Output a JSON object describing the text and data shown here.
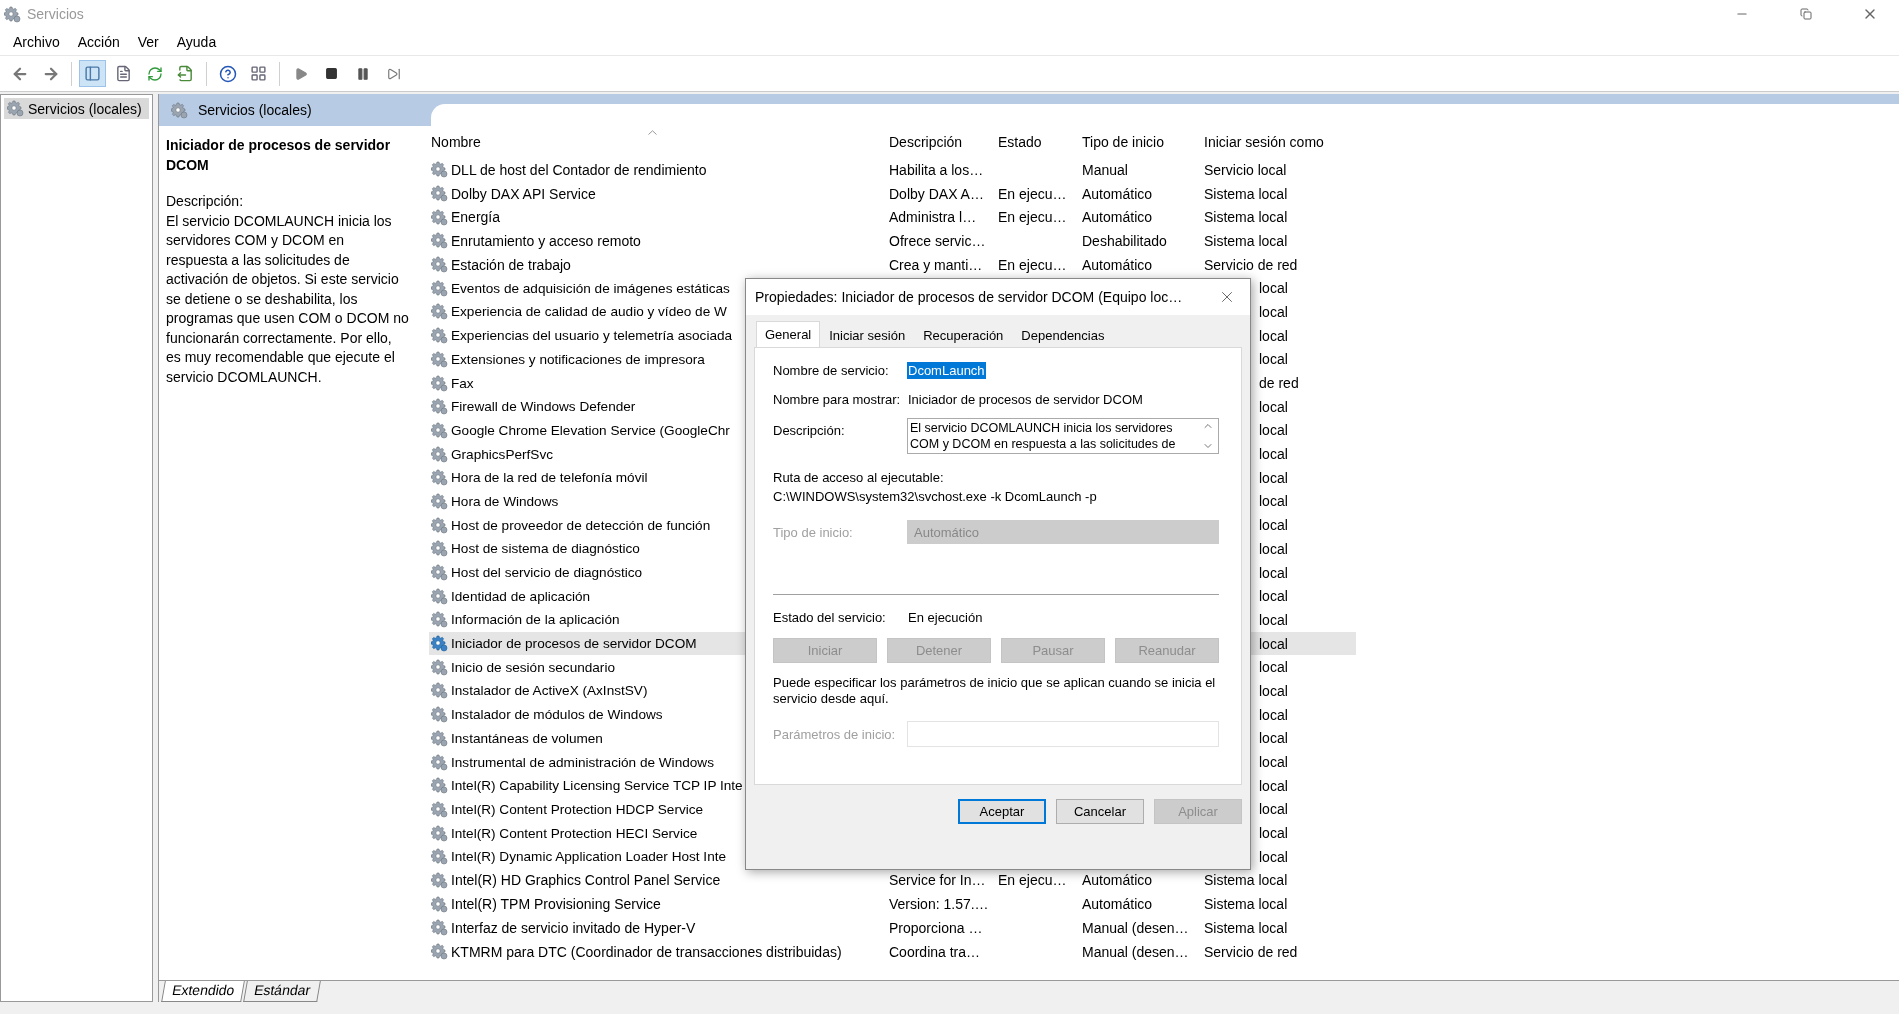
{
  "window": {
    "title": "Servicios"
  },
  "menu": [
    "Archivo",
    "Acción",
    "Ver",
    "Ayuda"
  ],
  "tree": {
    "items": [
      {
        "label": "Servicios (locales)",
        "selected": true
      }
    ]
  },
  "panel": {
    "title": "Servicios (locales)"
  },
  "details": {
    "title": "Iniciador de procesos de servidor DCOM",
    "description_label": "Descripción:",
    "description": "El servicio DCOMLAUNCH inicia los servidores COM y DCOM en respuesta a las solicitudes de activación de objetos. Si este servicio se detiene o se deshabilita, los programas que usen COM o DCOM no funcionarán correctamente. Por ello, es muy recomendable que ejecute el servicio DCOMLAUNCH."
  },
  "table": {
    "columns": [
      "Nombre",
      "Descripción",
      "Estado",
      "Tipo de inicio",
      "Iniciar sesión como"
    ],
    "rows": [
      {
        "kind": "full",
        "name": "DLL de host del Contador de rendimiento",
        "description": "Habilita a los…",
        "startup": "Manual",
        "logon": "Servicio local",
        "selected": false
      },
      {
        "kind": "full",
        "name": "Dolby DAX API Service",
        "description": "Dolby DAX A…",
        "status": "En ejecu…",
        "startup": "Automático",
        "logon": "Sistema local",
        "selected": false
      },
      {
        "kind": "full",
        "name": "Energía",
        "description": "Administra l…",
        "status": "En ejecu…",
        "startup": "Automático",
        "logon": "Sistema local",
        "selected": false
      },
      {
        "kind": "full",
        "name": "Enrutamiento y acceso remoto",
        "description": "Ofrece servic…",
        "startup": "Deshabilitado",
        "logon": "Sistema local",
        "selected": false
      },
      {
        "kind": "full",
        "name": "Estación de trabajo",
        "description": "Crea y manti…",
        "status": "En ejecu…",
        "startup": "Automático",
        "logon": "Servicio de red",
        "selected": false
      },
      {
        "kind": "covered",
        "name": "Eventos de adquisición de imágenes estáticas",
        "logon": "local",
        "selected": false
      },
      {
        "kind": "covered",
        "name": "Experiencia de calidad de audio y vídeo de W",
        "logon": "local",
        "selected": false
      },
      {
        "kind": "covered",
        "name": "Experiencias del usuario y telemetría asociada",
        "logon": "local",
        "selected": false
      },
      {
        "kind": "covered",
        "name": "Extensiones y notificaciones de impresora",
        "logon": "local",
        "selected": false
      },
      {
        "kind": "covered",
        "name": "Fax",
        "logon": "de red",
        "selected": false
      },
      {
        "kind": "covered",
        "name": "Firewall de Windows Defender",
        "logon": "local",
        "selected": false
      },
      {
        "kind": "covered",
        "name": "Google Chrome Elevation Service (GoogleChr",
        "logon": "local",
        "selected": false
      },
      {
        "kind": "covered",
        "name": "GraphicsPerfSvc",
        "logon": "local",
        "selected": false
      },
      {
        "kind": "covered",
        "name": "Hora de la red de telefonía móvil",
        "logon": "local",
        "selected": false
      },
      {
        "kind": "covered",
        "name": "Hora de Windows",
        "logon": "local",
        "selected": false
      },
      {
        "kind": "covered",
        "name": "Host de proveedor de detección de función",
        "logon": "local",
        "selected": false
      },
      {
        "kind": "covered",
        "name": "Host de sistema de diagnóstico",
        "logon": "local",
        "selected": false
      },
      {
        "kind": "covered",
        "name": "Host del servicio de diagnóstico",
        "logon": "local",
        "selected": false
      },
      {
        "kind": "covered",
        "name": "Identidad de aplicación",
        "logon": "local",
        "selected": false
      },
      {
        "kind": "covered",
        "name": "Información de la aplicación",
        "logon": "local",
        "selected": false
      },
      {
        "kind": "covered",
        "name": "Iniciador de procesos de servidor DCOM",
        "logon": "local",
        "selected": true
      },
      {
        "kind": "covered",
        "name": "Inicio de sesión secundario",
        "logon": "local",
        "selected": false
      },
      {
        "kind": "covered",
        "name": "Instalador de ActiveX (AxInstSV)",
        "logon": "local",
        "selected": false
      },
      {
        "kind": "covered",
        "name": "Instalador de módulos de Windows",
        "logon": "local",
        "selected": false
      },
      {
        "kind": "covered",
        "name": "Instantáneas de volumen",
        "logon": "local",
        "selected": false
      },
      {
        "kind": "covered",
        "name": "Instrumental de administración de Windows",
        "logon": "local",
        "selected": false
      },
      {
        "kind": "covered",
        "name": "Intel(R) Capability Licensing Service TCP IP Inte",
        "logon": "local",
        "selected": false
      },
      {
        "kind": "covered",
        "name": "Intel(R) Content Protection HDCP Service",
        "logon": "local",
        "selected": false
      },
      {
        "kind": "covered",
        "name": "Intel(R) Content Protection HECI Service",
        "logon": "local",
        "selected": false
      },
      {
        "kind": "covered",
        "name": "Intel(R) Dynamic Application Loader Host Inte",
        "logon": "local",
        "selected": false
      },
      {
        "kind": "full",
        "name": "Intel(R) HD Graphics Control Panel Service",
        "description": "Service for In…",
        "status": "En ejecu…",
        "startup": "Automático",
        "logon": "Sistema local",
        "selected": false
      },
      {
        "kind": "full",
        "name": "Intel(R) TPM Provisioning Service",
        "description": "Version: 1.57.…",
        "startup": "Automático",
        "logon": "Sistema local",
        "selected": false
      },
      {
        "kind": "full",
        "name": "Interfaz de servicio invitado de Hyper-V",
        "description": "Proporciona …",
        "startup": "Manual (desen…",
        "logon": "Sistema local",
        "selected": false
      },
      {
        "kind": "full",
        "name": "KTMRM para DTC (Coordinador de transacciones distribuidas)",
        "description": "Coordina tra…",
        "startup": "Manual (desen…",
        "logon": "Servicio de red",
        "selected": false
      }
    ]
  },
  "view_tabs": [
    {
      "label": "Extendido",
      "selected": true
    },
    {
      "label": "Estándar",
      "selected": false
    }
  ],
  "dialog": {
    "title": "Propiedades: Iniciador de procesos de servidor DCOM (Equipo loc…",
    "tabs": [
      {
        "label": "General",
        "selected": true
      },
      {
        "label": "Iniciar sesión",
        "selected": false
      },
      {
        "label": "Recuperación",
        "selected": false
      },
      {
        "label": "Dependencias",
        "selected": false
      }
    ],
    "service_name": {
      "label": "Nombre de servicio:",
      "value": "DcomLaunch",
      "selected": true
    },
    "display_name": {
      "label": "Nombre para mostrar:",
      "value": "Iniciador de procesos de servidor DCOM"
    },
    "description": {
      "label": "Descripción:",
      "value": "El servicio DCOMLAUNCH inicia los servidores COM y DCOM en respuesta a las solicitudes de"
    },
    "path": {
      "label": "Ruta de acceso al ejecutable:",
      "value": "C:\\WINDOWS\\system32\\svchost.exe -k DcomLaunch -p"
    },
    "startup_type": {
      "label": "Tipo de inicio:",
      "value": "Automático",
      "disabled": true
    },
    "status": {
      "label": "Estado del servicio:",
      "value": "En ejecución"
    },
    "service_buttons": [
      {
        "label": "Iniciar",
        "disabled": true
      },
      {
        "label": "Detener",
        "disabled": true
      },
      {
        "label": "Pausar",
        "disabled": true
      },
      {
        "label": "Reanudar",
        "disabled": true
      }
    ],
    "note": "Puede especificar los parámetros de inicio que se aplican cuando se inicia el servicio desde aquí.",
    "parameters": {
      "label": "Parámetros de inicio:",
      "disabled": true
    },
    "buttons": [
      {
        "label": "Aceptar",
        "disabled": false,
        "focused": true
      },
      {
        "label": "Cancelar",
        "disabled": false,
        "focused": false
      },
      {
        "label": "Aplicar",
        "disabled": true,
        "focused": false
      }
    ]
  }
}
